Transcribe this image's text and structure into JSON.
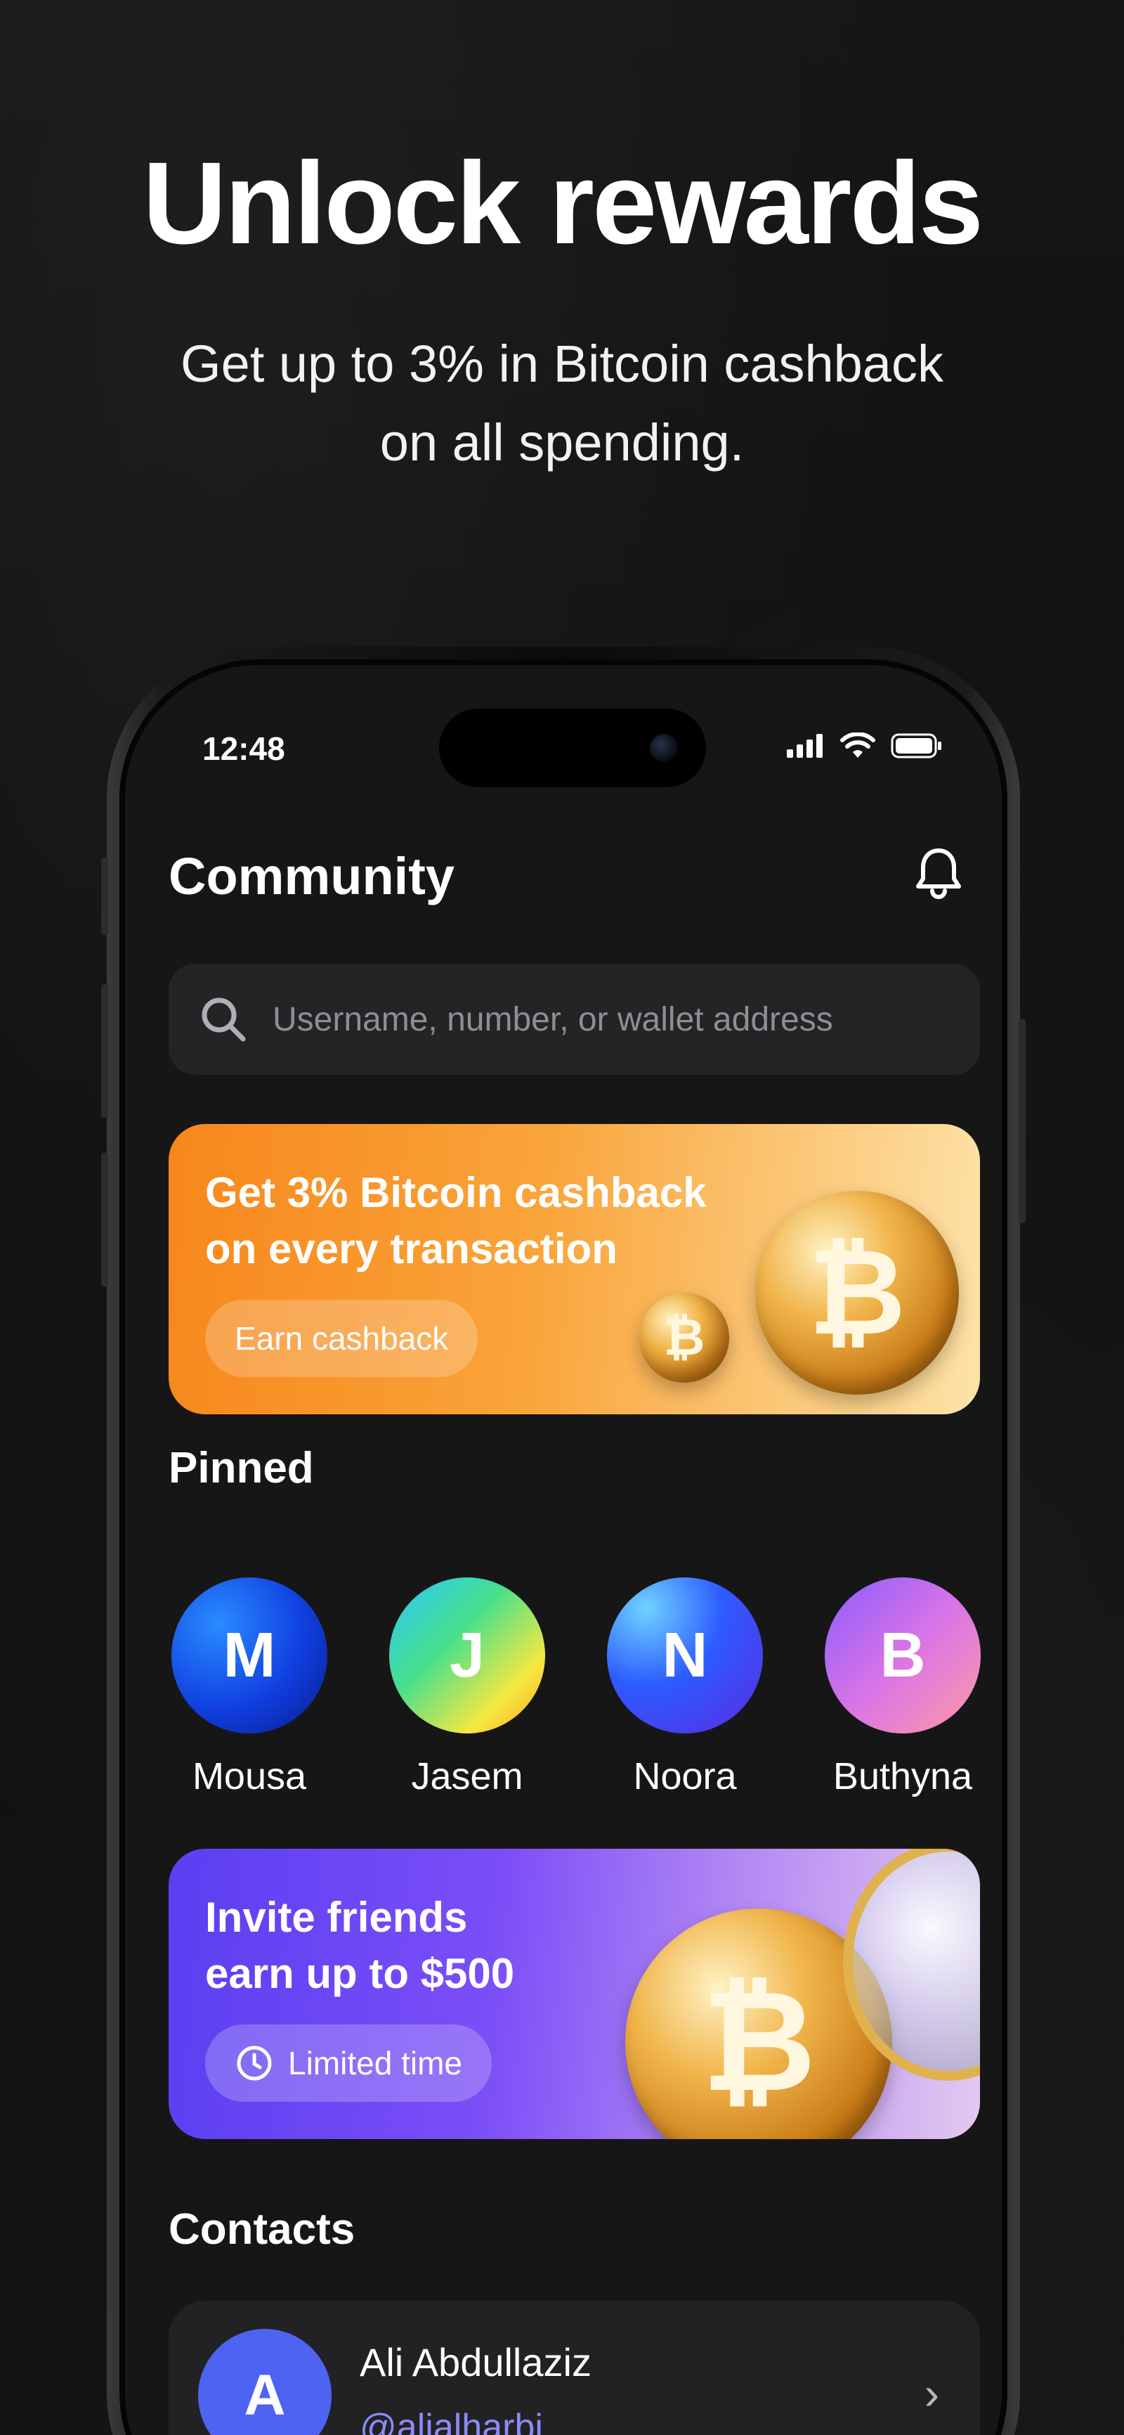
{
  "marketing": {
    "headline": "Unlock rewards",
    "subline_1": "Get  up to 3% in Bitcoin cashback",
    "subline_2": "on all spending."
  },
  "status_bar": {
    "time": "12:48"
  },
  "header": {
    "title": "Community"
  },
  "search": {
    "placeholder": "Username, number, or wallet address"
  },
  "cashback_banner": {
    "title_line_1": "Get 3% Bitcoin cashback",
    "title_line_2": "on every transaction",
    "button_label": "Earn cashback"
  },
  "pinned": {
    "title": "Pinned",
    "items": [
      {
        "initial": "M",
        "name": "Mousa"
      },
      {
        "initial": "J",
        "name": "Jasem"
      },
      {
        "initial": "N",
        "name": "Noora"
      },
      {
        "initial": "B",
        "name": "Buthyna"
      }
    ]
  },
  "invite_banner": {
    "title_line_1": "Invite friends",
    "title_line_2": "earn up to $500",
    "badge_label": "Limited time"
  },
  "contacts": {
    "title": "Contacts",
    "items": [
      {
        "initial": "A",
        "name": "Ali Abdullaziz",
        "handle": "@alialharbi"
      }
    ]
  },
  "colors": {
    "background": "#121212",
    "screen": "#161617",
    "card": "#222224",
    "cashback_orange": "#f7871c",
    "invite_purple": "#5b3ff1",
    "handle_accent": "#8a8cf6",
    "contact_avatar": "#4e63f2"
  },
  "icons": [
    "bell-icon",
    "search-icon",
    "clock-icon",
    "chevron-right-icon",
    "signal-icon",
    "wifi-icon",
    "battery-icon",
    "bitcoin-coin-icon"
  ]
}
